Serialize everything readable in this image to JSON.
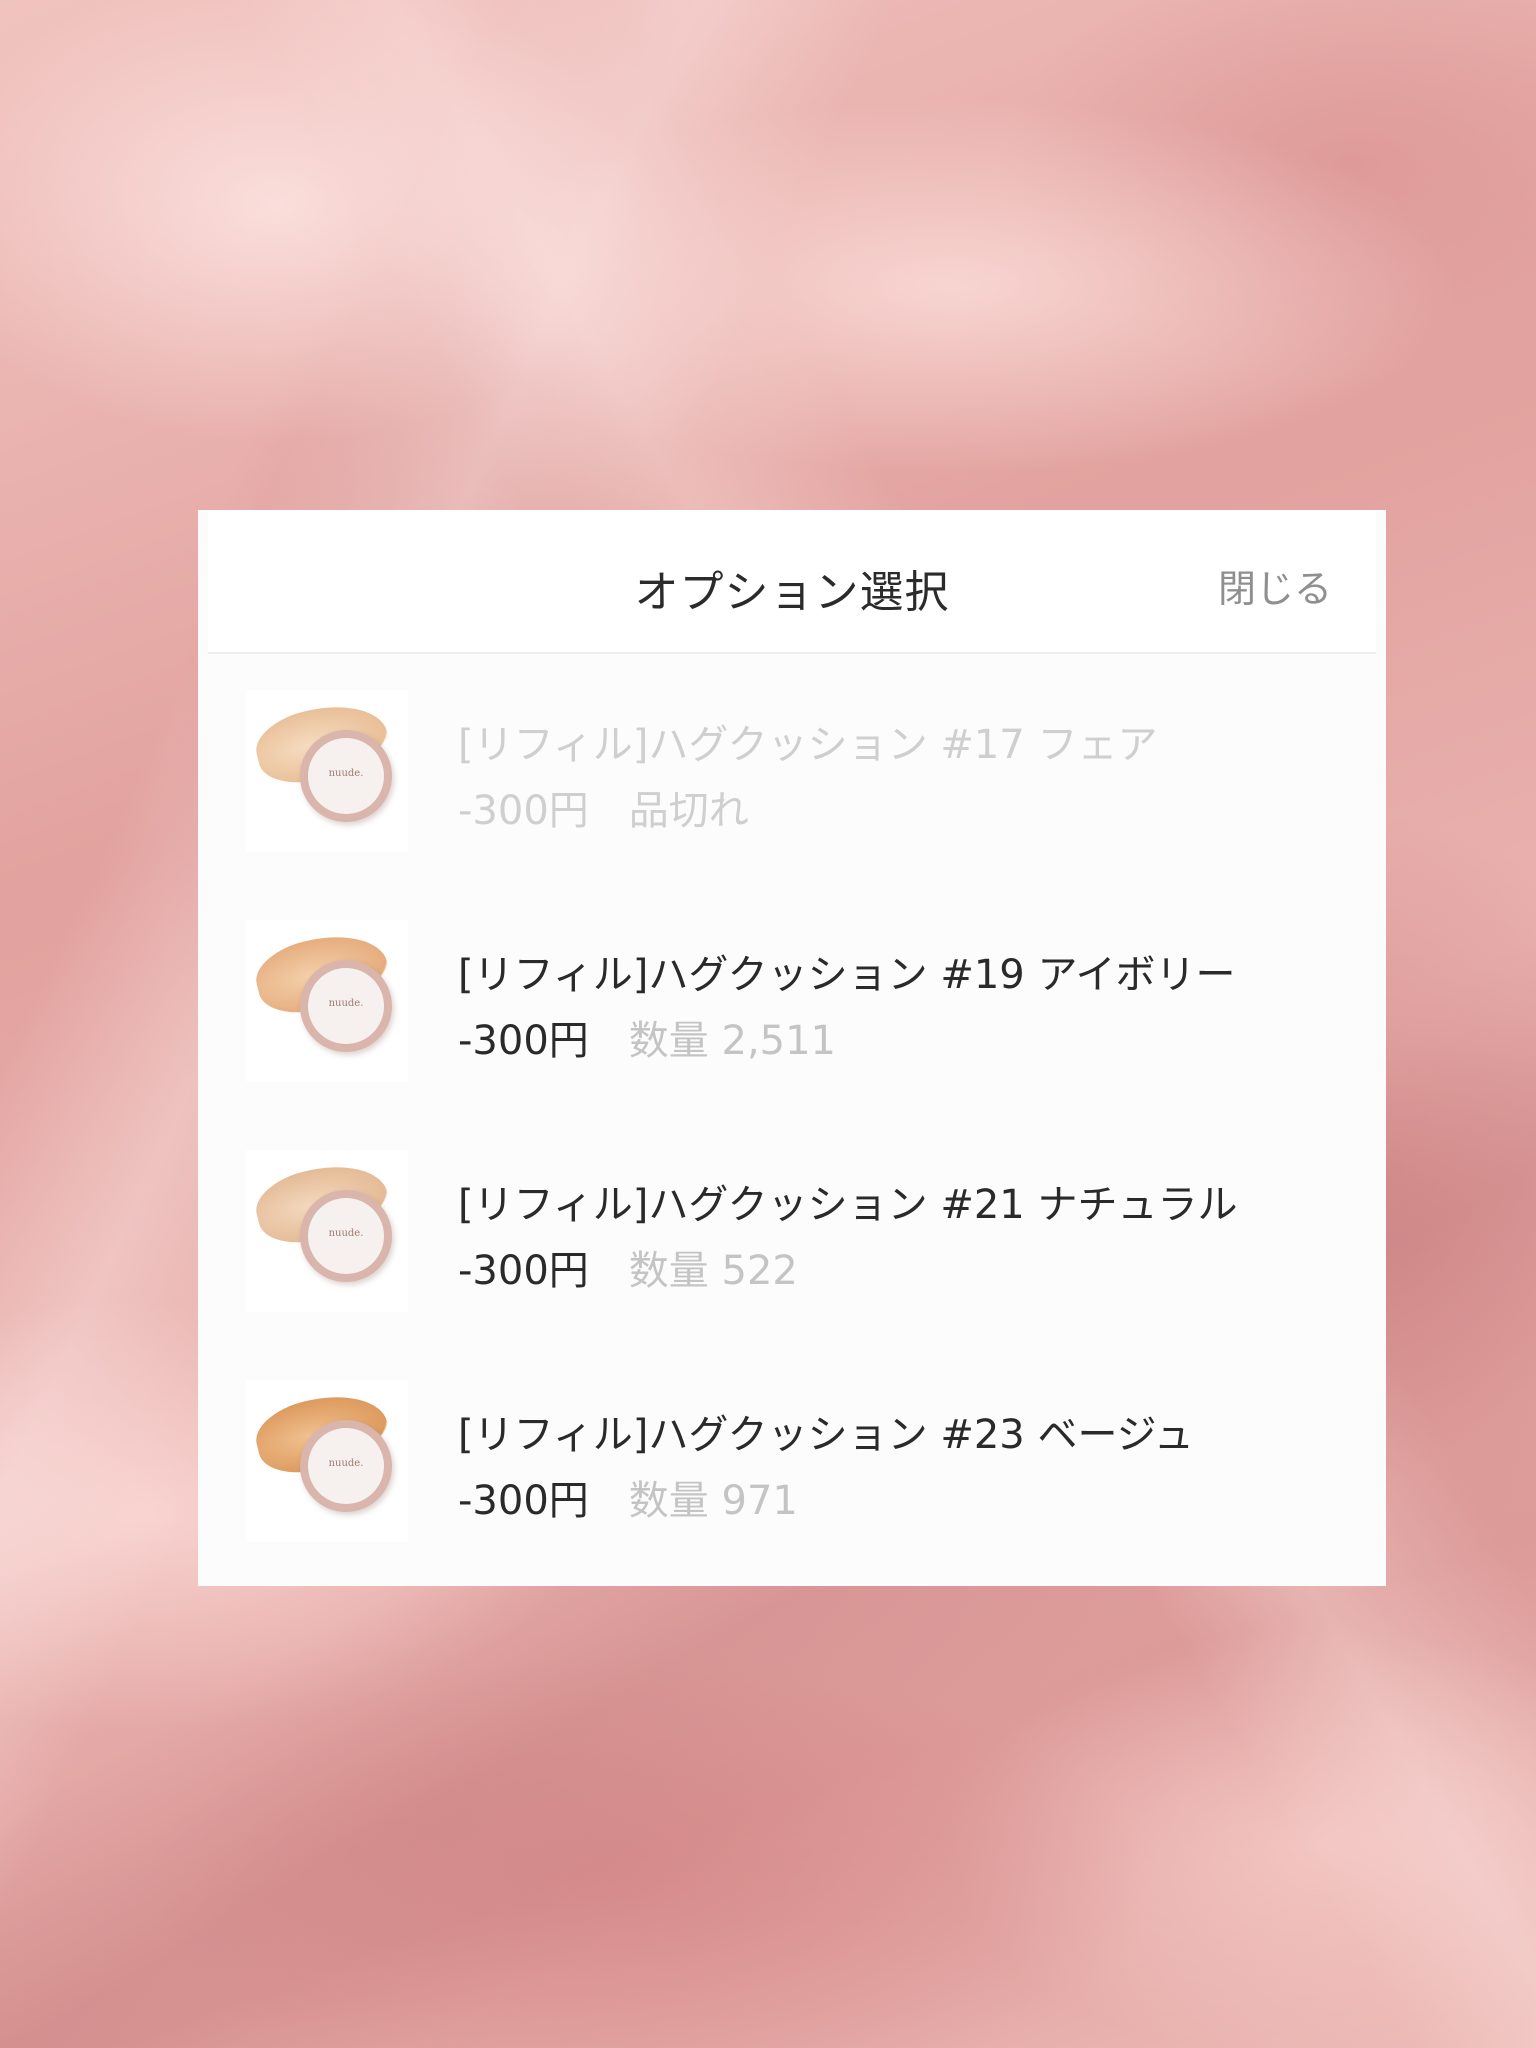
{
  "modal": {
    "title": "オプション選択",
    "close_label": "閉じる"
  },
  "options": [
    {
      "name": "[リフィル]ハグクッション #17 フェア",
      "price": "-300円",
      "stock": "品切れ",
      "sold_out": true,
      "swatch_color": "#f1d1b1"
    },
    {
      "name": "[リフィル]ハグクッション #19 アイボリー",
      "price": "-300円",
      "stock": "数量 2,511",
      "sold_out": false,
      "swatch_color": "#efc39c"
    },
    {
      "name": "[リフィル]ハグクッション #21 ナチュラル",
      "price": "-300円",
      "stock": "数量 522",
      "sold_out": false,
      "swatch_color": "#efd0b2"
    },
    {
      "name": "[リフィル]ハグクッション #23 ベージュ",
      "price": "-300円",
      "stock": "数量 971",
      "sold_out": false,
      "swatch_color": "#edb883"
    }
  ],
  "product_logo": "nuude."
}
